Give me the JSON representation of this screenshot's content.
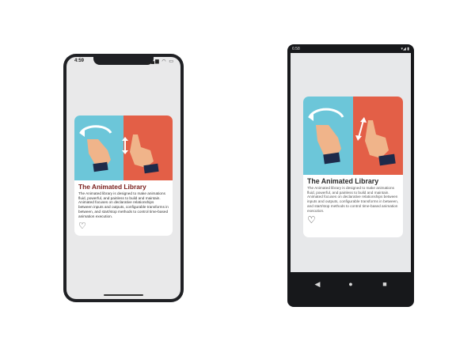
{
  "ios": {
    "status_time": "4:59",
    "status_icons": "▂▄▆ ◠ ▭"
  },
  "android": {
    "status_time": "6:58",
    "status_icons": "▾◢ ▮",
    "nav": {
      "back": "◀",
      "home": "●",
      "recent": "■"
    }
  },
  "card": {
    "title": "The Animated Library",
    "description": "The Animated library is designed to make animations fluid, powerful, and painless to build and maintain. Animated focuses on declarative relationships between inputs and outputs, configurable transforms in between, and start/stop methods to control time-based animation execution.",
    "like_icon": "heart-icon"
  },
  "colors": {
    "panel_left": "#6cc6d9",
    "panel_right": "#e35f47",
    "ios_title": "#7a1f1c",
    "android_title": "#2a2a2a",
    "hand": "#f0b48a",
    "sleeve": "#1e2a4a"
  }
}
